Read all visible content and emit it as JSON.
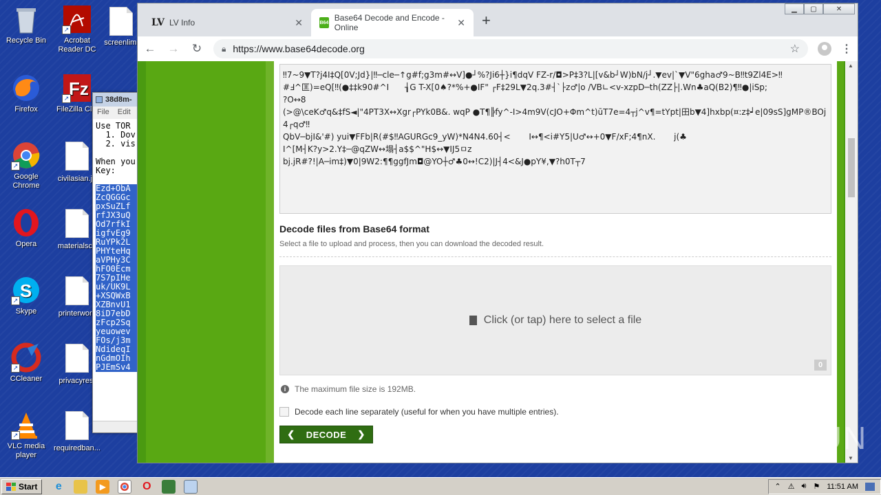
{
  "desktop": {
    "icons": [
      {
        "label": "Recycle Bin",
        "icon": "recycle-bin-icon"
      },
      {
        "label": "Acrobat Reader DC",
        "icon": "acrobat-icon"
      },
      {
        "label": "screenlimi",
        "icon": "document-icon"
      },
      {
        "label": "Firefox",
        "icon": "firefox-icon"
      },
      {
        "label": "FileZilla Clie",
        "icon": "filezilla-icon"
      },
      {
        "label": "Google Chrome",
        "icon": "chrome-icon"
      },
      {
        "label": "civilasian.jp",
        "icon": "document-icon"
      },
      {
        "label": "Opera",
        "icon": "opera-icon"
      },
      {
        "label": "materialsco",
        "icon": "document-icon"
      },
      {
        "label": "Skype",
        "icon": "skype-icon"
      },
      {
        "label": "printerwork",
        "icon": "document-icon"
      },
      {
        "label": "CCleaner",
        "icon": "ccleaner-icon"
      },
      {
        "label": "privacyrest",
        "icon": "document-icon"
      },
      {
        "label": "VLC media player",
        "icon": "vlc-icon"
      },
      {
        "label": "requiredban...",
        "icon": "document-icon"
      }
    ]
  },
  "notepad": {
    "title": "38d8m-",
    "menu": [
      "File",
      "Edit"
    ],
    "lines": [
      "Use TOR",
      "  1. Dov",
      "  2. vis",
      "",
      "When you",
      "Key:"
    ],
    "selected_lines": [
      "Ezd+ObA",
      "ZcQGGGc",
      "pxSuZLf",
      "rfJX3uQ",
      "Od7rfkI",
      "igfvEg9",
      "RuYPk2L",
      "PHYteHq",
      "aVPHy3C",
      "hFO0Ecm",
      "7S7pIHe",
      "uk/UK9L",
      "+XSQWxB",
      "XZBnvU1",
      "8iD7ebD",
      "zFcp2Sq",
      "yeuowev",
      "FOs/j3m",
      "NdideqI",
      "nGdmOIh",
      "PJEmSv4"
    ]
  },
  "browser": {
    "tabs": [
      {
        "title": "LV Info",
        "favicon": "LV"
      },
      {
        "title": "Base64 Decode and Encode - Online",
        "favicon": "B64"
      }
    ],
    "url": "https://www.base64decode.org",
    "page": {
      "decoded_output": "‼7~9▼T?j4I‡Q[0V;Jd}|‼─cle─↑g#f;g3m#↔V]●┘%?Ji6┼}i¶dqV FZ-r/◘>P‡3?L|[v&b┘W)bN/j┘.▼ev|`▼V\"6gha♂9~B‼t9Zl4E>‼\n#Ⅎ^匡)=eQ[‼(●‡‡k90#^I      ┧G T-X[0♠?*%+●IF\" ┌F‡29L▼2q.3#┤`├z♂|o /VB∟<v-xzpD─th(ZZ├|.Wn♣aQ(B2)¶‼●|iSp;\n?O↔8\n(>@\\ceK♂q&‡fS◄|\"4PT3X↔Xgr┌PYk0B&. wqP ●T¶╠fy^-I>4m9V(cJO+Φm^t)ūT7e=4┬j^v¶=tYpt|田b▼4]hxbp(¤:z‡┙e|09sS]gMP®BOj4┌q♂‼\nQbV─bjI&'#) yui▼FFb|R(#$‼AGURGc9_yW)*N4N4.60┤<       I↔¶<i#Y5|U♂↔+0▼F/xF;4¶nX.       j(♣\nI^[M┤K?y>2.Y‡─@qZW↔塌┤a$$^\"H$↔▼IJ5ㅁz\nbj.jR#?!|A─im‡)▼0|9W2:¶¶ggfJm◘@YO┼♂♣0↔!C2)|J┤4<&J●pY¥,▼?h0T┬7",
      "section_title": "Decode files from Base64 format",
      "section_subtitle": "Select a file to upload and process, then you can download the decoded result.",
      "dropzone_label": "Click (or tap) here to select a file",
      "file_count": "0",
      "max_size_note": "The maximum file size is 192MB.",
      "checkbox_label": "Decode each line separately (useful for when you have multiple entries).",
      "decode_button": "DECODE"
    }
  },
  "watermark": "ANY RUN",
  "taskbar": {
    "start_label": "Start",
    "clock": "11:51 AM"
  },
  "colors": {
    "desktop": "#1d3fa0",
    "site_green": "#4a9a11",
    "decode_button": "#2f6d12"
  }
}
